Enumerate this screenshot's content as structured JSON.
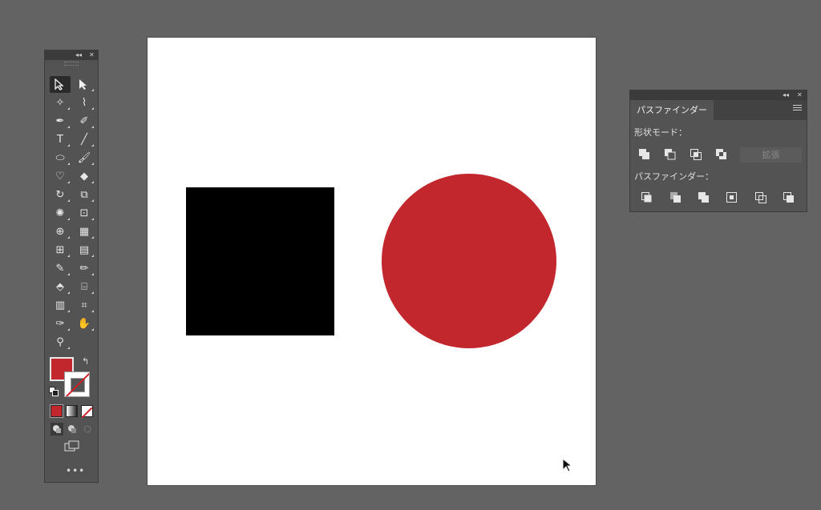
{
  "colors": {
    "fill": "#c1272d",
    "canvas": "#636363",
    "panel": "#535353"
  },
  "tools_panel": {
    "collapse_glyph": "◂◂",
    "close_glyph": "✕",
    "tools": [
      {
        "name": "selection-tool-icon",
        "glyph": "",
        "active": true
      },
      {
        "name": "direct-selection-tool-icon",
        "glyph": ""
      },
      {
        "name": "magic-wand-tool-icon",
        "glyph": "✧"
      },
      {
        "name": "lasso-tool-icon",
        "glyph": "⌇"
      },
      {
        "name": "pen-tool-icon",
        "glyph": "✒"
      },
      {
        "name": "curvature-tool-icon",
        "glyph": "✐"
      },
      {
        "name": "type-tool-icon",
        "glyph": "T"
      },
      {
        "name": "line-segment-tool-icon",
        "glyph": "╱"
      },
      {
        "name": "ellipse-tool-icon",
        "glyph": "⬭"
      },
      {
        "name": "paintbrush-tool-icon",
        "glyph": "🖌"
      },
      {
        "name": "shaper-tool-icon",
        "glyph": "♡"
      },
      {
        "name": "eraser-tool-icon",
        "glyph": "◆"
      },
      {
        "name": "rotate-tool-icon",
        "glyph": "↻"
      },
      {
        "name": "scale-tool-icon",
        "glyph": "⧉"
      },
      {
        "name": "puppet-warp-tool-icon",
        "glyph": "✺"
      },
      {
        "name": "free-transform-tool-icon",
        "glyph": "⊡"
      },
      {
        "name": "shape-builder-tool-icon",
        "glyph": "⊕"
      },
      {
        "name": "perspective-grid-tool-icon",
        "glyph": "▦"
      },
      {
        "name": "mesh-tool-icon",
        "glyph": "⊞"
      },
      {
        "name": "gradient-tool-icon",
        "glyph": "▤"
      },
      {
        "name": "blend-tool-icon",
        "glyph": "✎"
      },
      {
        "name": "eyedropper-tool-icon",
        "glyph": "✏"
      },
      {
        "name": "live-paint-bucket-tool-icon",
        "glyph": "⬘"
      },
      {
        "name": "symbol-sprayer-tool-icon",
        "glyph": "⌸"
      },
      {
        "name": "column-graph-tool-icon",
        "glyph": "▥"
      },
      {
        "name": "artboard-tool-icon",
        "glyph": "⌗"
      },
      {
        "name": "slice-tool-icon",
        "glyph": "✑"
      },
      {
        "name": "hand-tool-icon",
        "glyph": "✋"
      },
      {
        "name": "zoom-tool-icon",
        "glyph": "⚲"
      }
    ],
    "swap_glyph": "↰",
    "more_glyph": "•••"
  },
  "pathfinder_panel": {
    "collapse_glyph": "◂◂",
    "close_glyph": "✕",
    "tab_label": "パスファインダー",
    "shape_modes_label": "形状モード：",
    "expand_label": "拡張",
    "pathfinders_label": "パスファインダー："
  }
}
